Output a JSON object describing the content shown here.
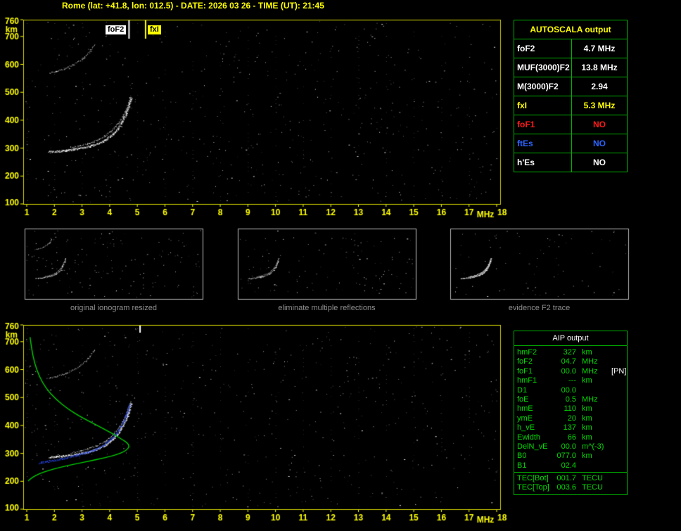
{
  "title": "Rome (lat: +41.8, lon: 012.5) - DATE: 2026 03 26 - TIME (UT): 21:45",
  "palette": {
    "white": "#ffffff",
    "yellow": "#ffff00",
    "red": "#ff1a1a",
    "blue": "#2e64fe",
    "green": "#00d800"
  },
  "autoscala": {
    "title": "AUTOSCALA output",
    "rows": [
      {
        "label": "foF2",
        "value": "4.7 MHz",
        "label_color": "white",
        "value_color": "white"
      },
      {
        "label": "MUF(3000)F2",
        "value": "13.8 MHz",
        "label_color": "white",
        "value_color": "white"
      },
      {
        "label": "M(3000)F2",
        "value": "2.94",
        "label_color": "white",
        "value_color": "white"
      },
      {
        "label": "fxI",
        "value": "5.3 MHz",
        "label_color": "yellow",
        "value_color": "yellow"
      },
      {
        "label": "foF1",
        "value": "NO",
        "label_color": "red",
        "value_color": "red"
      },
      {
        "label": "ftEs",
        "value": "NO",
        "label_color": "blue",
        "value_color": "blue"
      },
      {
        "label": "h'Es",
        "value": "NO",
        "label_color": "white",
        "value_color": "white"
      }
    ]
  },
  "aip": {
    "title": "AIP output",
    "rows": [
      {
        "name": "hmF2",
        "value": "327",
        "unit": "km",
        "extra": ""
      },
      {
        "name": "foF2",
        "value": "04.7",
        "unit": "MHz",
        "extra": ""
      },
      {
        "name": "foF1",
        "value": "00.0",
        "unit": "MHz",
        "extra": "[PN]"
      },
      {
        "name": "hmF1",
        "value": "---",
        "unit": "km",
        "extra": ""
      },
      {
        "name": "D1",
        "value": "00.0",
        "unit": "",
        "extra": ""
      },
      {
        "name": "foE",
        "value": "0.5",
        "unit": "MHz",
        "extra": ""
      },
      {
        "name": "hmE",
        "value": "110",
        "unit": "km",
        "extra": ""
      },
      {
        "name": "ymE",
        "value": "20",
        "unit": "km",
        "extra": ""
      },
      {
        "name": "h_vE",
        "value": "137",
        "unit": "km",
        "extra": ""
      },
      {
        "name": "Ewidth",
        "value": "66",
        "unit": "km",
        "extra": ""
      },
      {
        "name": "DelN_vE",
        "value": "00.0",
        "unit": "m^(-3)",
        "extra": ""
      },
      {
        "name": "B0",
        "value": "077.0",
        "unit": "km",
        "extra": ""
      },
      {
        "name": "B1",
        "value": "02.4",
        "unit": "",
        "extra": ""
      }
    ],
    "tec_rows": [
      {
        "name": "TEC[Bot]",
        "value": "001.7",
        "unit": "TECU"
      },
      {
        "name": "TEC[Top]",
        "value": "003.6",
        "unit": "TECU"
      }
    ]
  },
  "thumbnails": [
    {
      "caption": "original ionogram resized",
      "noise_dots": 150,
      "layers": [
        "f2-trace-o",
        "f2-trace-x",
        "f2-second-hop"
      ]
    },
    {
      "caption": "eliminate multiple reflections",
      "noise_dots": 120,
      "layers": [
        "f2-trace-o",
        "f2-trace-x"
      ]
    },
    {
      "caption": "evidence F2 trace",
      "noise_dots": 75,
      "layers": [
        "f2-trace-o",
        "f2-trace-x"
      ]
    }
  ],
  "chart_data": [
    {
      "type": "scatter",
      "name": "main ionogram (echo trace)",
      "xlabel": "MHz",
      "ylabel": "km",
      "xlim": [
        1,
        18
      ],
      "ylim": [
        100,
        760
      ],
      "xticks": [
        1,
        2,
        3,
        4,
        5,
        6,
        7,
        8,
        9,
        10,
        11,
        12,
        13,
        14,
        15,
        16,
        17,
        18
      ],
      "yticks": [
        100,
        200,
        300,
        400,
        500,
        600,
        700,
        760
      ],
      "noise_dots": 560,
      "markers": [
        {
          "label": "foF2",
          "freq": 4.7,
          "color": "#ffffff"
        },
        {
          "label": "fxI",
          "freq": 5.3,
          "color": "#ffff00"
        }
      ],
      "traces": [
        {
          "name": "f2-trace-o",
          "color": "#ffffff",
          "points": [
            [
              1.8,
              287
            ],
            [
              2.1,
              289
            ],
            [
              2.4,
              292
            ],
            [
              2.7,
              296
            ],
            [
              3.0,
              301
            ],
            [
              3.3,
              308
            ],
            [
              3.6,
              318
            ],
            [
              3.85,
              331
            ],
            [
              4.1,
              349
            ],
            [
              4.3,
              371
            ],
            [
              4.45,
              395
            ],
            [
              4.6,
              425
            ],
            [
              4.7,
              455
            ],
            [
              4.77,
              482
            ]
          ]
        },
        {
          "name": "f2-trace-x",
          "color": "#e2e2e2",
          "points": [
            [
              2.6,
              303
            ],
            [
              2.9,
              309
            ],
            [
              3.2,
              317
            ],
            [
              3.5,
              328
            ],
            [
              3.8,
              343
            ],
            [
              4.05,
              362
            ],
            [
              4.3,
              388
            ],
            [
              4.5,
              420
            ],
            [
              4.65,
              455
            ],
            [
              4.75,
              488
            ]
          ]
        },
        {
          "name": "f2-second-hop",
          "color": "#d4d4d4",
          "points": [
            [
              1.8,
              570
            ],
            [
              2.1,
              577
            ],
            [
              2.4,
              587
            ],
            [
              2.7,
              601
            ],
            [
              3.0,
              620
            ],
            [
              3.25,
              645
            ],
            [
              3.45,
              672
            ]
          ]
        }
      ]
    },
    {
      "type": "scatter",
      "name": "ionogram with AUTOSCALA restored trace and Ne(h) profile",
      "xlabel": "MHz",
      "ylabel": "km",
      "xlim": [
        1,
        18
      ],
      "ylim": [
        100,
        760
      ],
      "xticks": [
        1,
        2,
        3,
        4,
        5,
        6,
        7,
        8,
        9,
        10,
        11,
        12,
        13,
        14,
        15,
        16,
        17,
        18
      ],
      "yticks": [
        100,
        200,
        300,
        400,
        500,
        600,
        700,
        760
      ],
      "noise_dots": 560,
      "includes_traces_from": "main ionogram (echo trace)",
      "marker_line": {
        "freq": 5.1,
        "color": "#ffffff"
      },
      "fitted_trace": {
        "name": "autoscala-restored-trace",
        "color": "#2b4bee",
        "points": [
          [
            1.45,
            266
          ],
          [
            1.8,
            272
          ],
          [
            2.15,
            279
          ],
          [
            2.5,
            286
          ],
          [
            2.85,
            294
          ],
          [
            3.2,
            304
          ],
          [
            3.5,
            316
          ],
          [
            3.8,
            332
          ],
          [
            4.05,
            352
          ],
          [
            4.3,
            380
          ],
          [
            4.5,
            415
          ],
          [
            4.65,
            452
          ],
          [
            4.72,
            478
          ]
        ]
      },
      "profile": {
        "name": "electron-density-profile",
        "color": "#00d000",
        "points": [
          [
            1.12,
            716
          ],
          [
            1.18,
            672
          ],
          [
            1.28,
            624
          ],
          [
            1.45,
            576
          ],
          [
            1.7,
            532
          ],
          [
            2.05,
            494
          ],
          [
            2.5,
            458
          ],
          [
            3.0,
            428
          ],
          [
            3.55,
            400
          ],
          [
            4.05,
            374
          ],
          [
            4.45,
            350
          ],
          [
            4.65,
            337
          ],
          [
            4.7,
            327
          ],
          [
            4.67,
            317
          ],
          [
            4.52,
            306
          ],
          [
            4.25,
            295
          ],
          [
            3.85,
            285
          ],
          [
            3.35,
            274
          ],
          [
            2.8,
            263
          ],
          [
            2.25,
            251
          ],
          [
            1.8,
            239
          ],
          [
            1.45,
            227
          ],
          [
            1.2,
            214
          ],
          [
            1.05,
            201
          ]
        ]
      }
    }
  ]
}
